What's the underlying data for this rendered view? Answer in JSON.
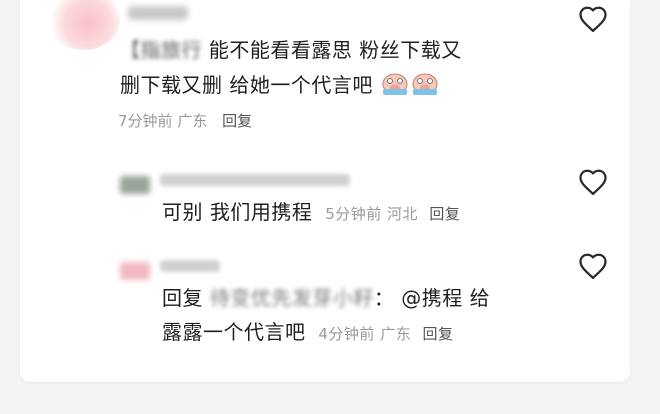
{
  "comment1": {
    "text_start": "【指旅行",
    "text_main": "能不能看看露思 粉丝下载又",
    "text_line2": "删下载又删 给她一个代言吧",
    "time": "7分钟前",
    "location": "广东",
    "reply": "回复"
  },
  "reply1": {
    "text": "可别 我们用携程",
    "time": "5分钟前",
    "location": "河北",
    "reply": "回复"
  },
  "reply2": {
    "prefix": "回复",
    "blurred_name": "待变优先发芽小籽",
    "colon": "：",
    "mention": "@携程",
    "text_end": "给",
    "text_line2": "露露一个代言吧",
    "time": "4分钟前",
    "location": "广东",
    "reply": "回复"
  },
  "icons": {
    "like": "heart-outline-icon",
    "sticker": "crying-pig-sticker"
  },
  "colors": {
    "text": "#1f1f1f",
    "meta": "#9a9a9a",
    "reply": "#555555",
    "background": "#f4f4f4"
  }
}
